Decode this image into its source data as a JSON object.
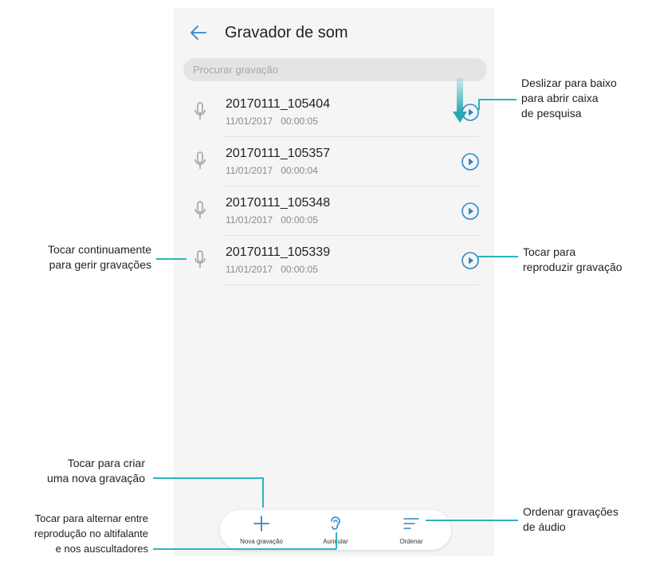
{
  "header": {
    "title": "Gravador de som"
  },
  "search": {
    "placeholder": "Procurar gravação"
  },
  "recordings": [
    {
      "name": "20170111_105404",
      "date": "11/01/2017",
      "duration": "00:00:05"
    },
    {
      "name": "20170111_105357",
      "date": "11/01/2017",
      "duration": "00:00:04"
    },
    {
      "name": "20170111_105348",
      "date": "11/01/2017",
      "duration": "00:00:05"
    },
    {
      "name": "20170111_105339",
      "date": "11/01/2017",
      "duration": "00:00:05"
    }
  ],
  "bottom_bar": {
    "new_recording": "Nova gravação",
    "earpiece": "Auricular",
    "sort": "Ordenar"
  },
  "icons": {
    "back": "back-arrow-icon",
    "mic": "microphone-icon",
    "play": "play-icon",
    "plus": "plus-icon",
    "ear": "ear-icon",
    "sort": "sort-icon",
    "swipe": "swipe-down-arrow-icon"
  },
  "colors": {
    "accent": "#2e86c7",
    "callout_line": "#2bb5b9",
    "swipe_arrow": "#26a9b0"
  },
  "callouts": {
    "swipe_1": "Deslizar para baixo",
    "swipe_2": "para abrir caixa",
    "swipe_3": "de pesquisa",
    "long_press_1": "Tocar continuamente",
    "long_press_2": "para gerir gravações",
    "play_1": "Tocar para",
    "play_2": "reproduzir gravação",
    "new_1": "Tocar para criar",
    "new_2": "uma nova gravação",
    "toggle_1": "Tocar para alternar entre",
    "toggle_2": "reprodução no altifalante",
    "toggle_3": "e nos auscultadores",
    "sort_1": "Ordenar gravações",
    "sort_2": "de áudio"
  }
}
